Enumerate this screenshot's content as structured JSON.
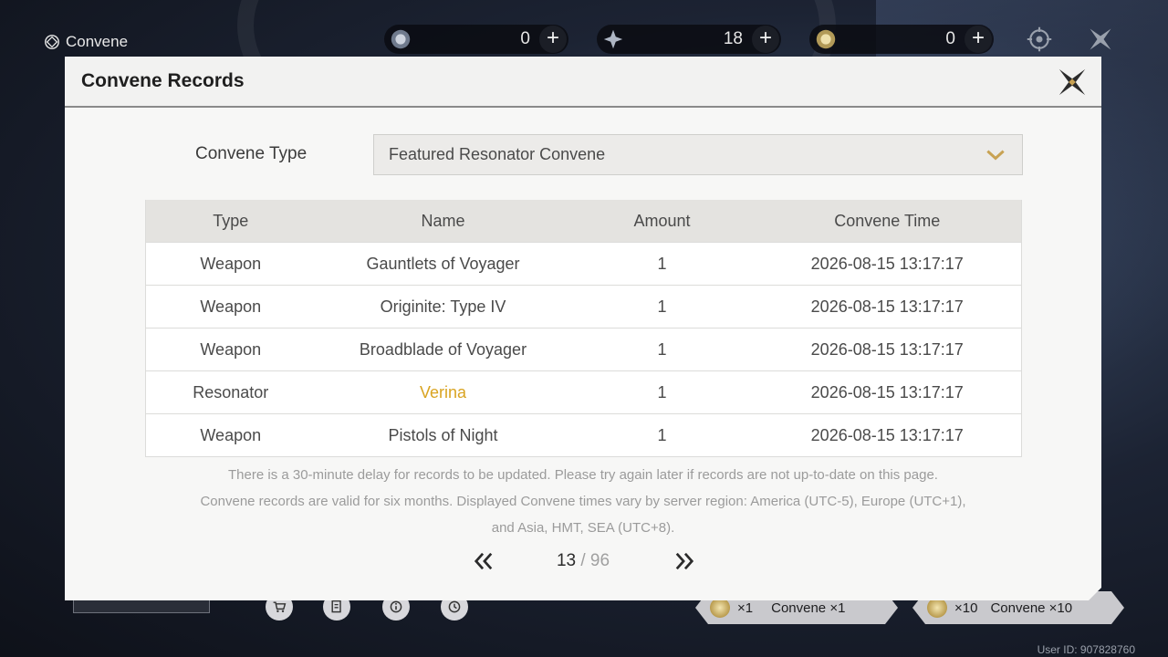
{
  "app": {
    "title": "Convene"
  },
  "currencies": [
    {
      "icon": "astrite-icon",
      "value": "0"
    },
    {
      "icon": "lunite-icon",
      "value": "18"
    },
    {
      "icon": "radiant-tide-icon",
      "value": "0"
    }
  ],
  "bottom": {
    "single_count": "×1",
    "single_label": "Convene ×1",
    "multi_count": "×10",
    "multi_label": "Convene ×10",
    "user_id": "User ID: 907828760"
  },
  "modal": {
    "title": "Convene Records",
    "type_label": "Convene Type",
    "selected_type": "Featured Resonator Convene",
    "columns": [
      "Type",
      "Name",
      "Amount",
      "Convene Time"
    ],
    "rows": [
      {
        "type": "Weapon",
        "name": "Gauntlets of Voyager",
        "amount": "1",
        "time": "2026-08-15 13:17:17",
        "highlight": false
      },
      {
        "type": "Weapon",
        "name": "Originite: Type IV",
        "amount": "1",
        "time": "2026-08-15 13:17:17",
        "highlight": false
      },
      {
        "type": "Weapon",
        "name": "Broadblade of Voyager",
        "amount": "1",
        "time": "2026-08-15 13:17:17",
        "highlight": false
      },
      {
        "type": "Resonator",
        "name": "Verina",
        "amount": "1",
        "time": "2026-08-15 13:17:17",
        "highlight": true
      },
      {
        "type": "Weapon",
        "name": "Pistols of Night",
        "amount": "1",
        "time": "2026-08-15 13:17:17",
        "highlight": false
      }
    ],
    "notice": [
      "There is a 30-minute delay for records to be updated. Please try again later if records are not up-to-date on this page.",
      "Convene records are valid for six months. Displayed Convene times vary by server region: America (UTC-5), Europe (UTC+1),",
      "and Asia, HMT, SEA (UTC+8)."
    ],
    "pager": {
      "current": "13",
      "separator": "/",
      "total": "96"
    }
  },
  "colors": {
    "highlight": "#d9a422",
    "accent": "#c8a253"
  }
}
